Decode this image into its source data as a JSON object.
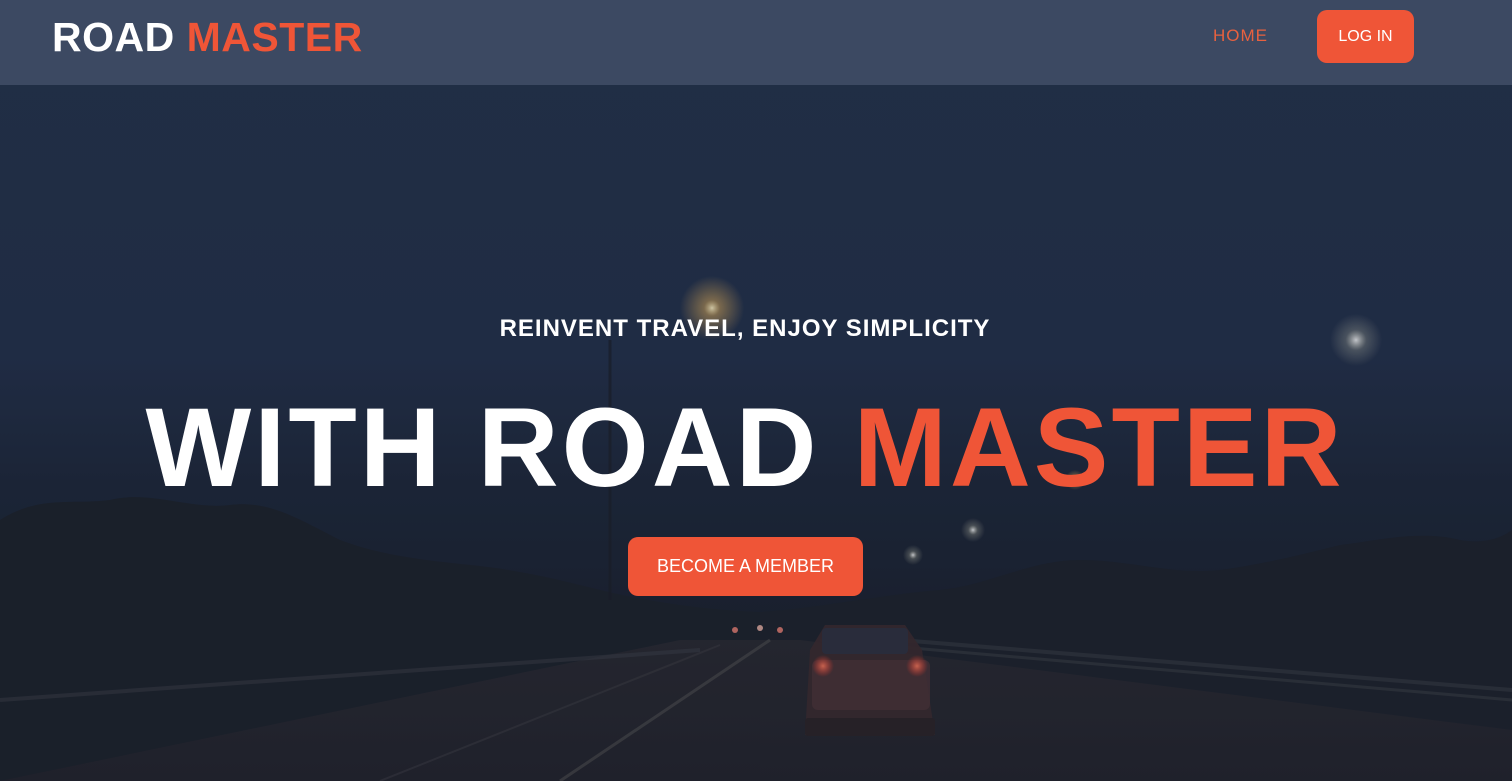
{
  "navbar": {
    "brand_white": "ROAD",
    "brand_orange": "MASTER",
    "home_label": "HOME",
    "login_label": "LOG IN"
  },
  "hero": {
    "subtitle": "REINVENT TRAVEL, ENJOY SIMPLICITY",
    "title_white": "WITH ROAD",
    "title_orange": "MASTER",
    "cta_label": "BECOME A MEMBER"
  },
  "colors": {
    "accent": "#ef5537",
    "navbar_bg": "#46556e",
    "text_light": "#ffffff"
  },
  "background": {
    "description_icon": "night-highway-photo"
  }
}
